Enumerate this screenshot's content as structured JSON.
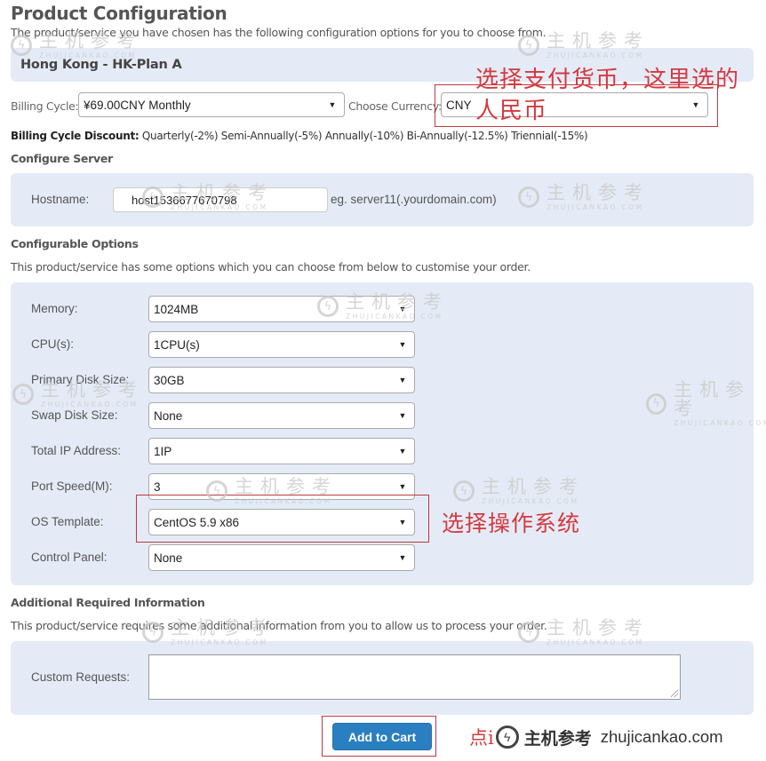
{
  "page": {
    "title": "Product Configuration",
    "intro": "The product/service you have chosen has the following configuration options for you to choose from."
  },
  "product": {
    "name": "Hong Kong - HK-Plan A"
  },
  "billing": {
    "cycle_label": "Billing Cycle:",
    "cycle_value": "¥69.00CNY Monthly",
    "currency_label": "Choose Currency:",
    "currency_value": "CNY",
    "discount_label": "Billing Cycle Discount:",
    "discount_text": "Quarterly(-2%) Semi-Annually(-5%) Annually(-10%) Bi-Annually(-12.5%) Triennial(-15%)"
  },
  "configure_server": {
    "heading": "Configure Server",
    "hostname_label": "Hostname:",
    "hostname_value": "host1536677670798",
    "hostname_hint": "eg. server11(.yourdomain.com)"
  },
  "configurable_options": {
    "heading": "Configurable Options",
    "description": "This product/service has some options which you can choose from below to customise your order.",
    "options": [
      {
        "label": "Memory:",
        "value": "1024MB"
      },
      {
        "label": "CPU(s):",
        "value": "1CPU(s)"
      },
      {
        "label": "Primary Disk Size:",
        "value": "30GB"
      },
      {
        "label": "Swap Disk Size:",
        "value": "None"
      },
      {
        "label": "Total IP Address:",
        "value": "1IP"
      },
      {
        "label": "Port Speed(M):",
        "value": "3"
      },
      {
        "label": "OS Template:",
        "value": "CentOS 5.9 x86"
      },
      {
        "label": "Control Panel:",
        "value": "None"
      }
    ]
  },
  "additional_info": {
    "heading": "Additional Required Information",
    "description": "This product/service requires some additional information from you to allow us to process your order.",
    "custom_requests_label": "Custom Requests:",
    "custom_requests_value": ""
  },
  "actions": {
    "add_to_cart": "Add to Cart"
  },
  "annotations": {
    "currency_note_line1": "选择支付货币，这里选的",
    "currency_note_line2": "人民币",
    "os_note": "选择操作系统",
    "cart_note_partial": "点i"
  },
  "watermark": {
    "cn": "主机参考",
    "en": "ZHUJICANKAO.COM",
    "footer_cn": "主机参考",
    "footer_en": "zhujicankao.com"
  },
  "icons": {
    "dropdown_arrow": "▼",
    "watermark_logo": "ϟ"
  }
}
